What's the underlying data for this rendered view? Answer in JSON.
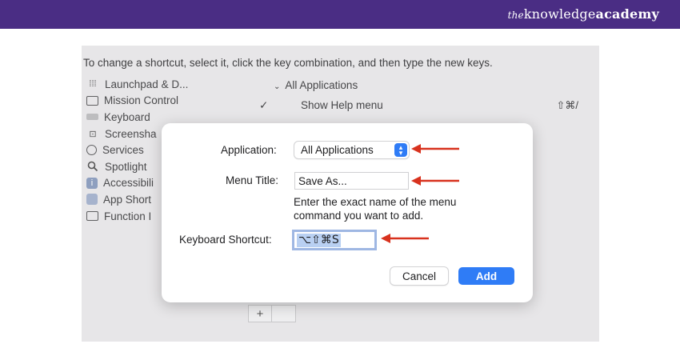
{
  "banner": {
    "brand_the": "the",
    "brand_knowledge": "knowledge",
    "brand_academy": "academy"
  },
  "instruction": "To change a shortcut, select it, click the key combination, and then type the new keys.",
  "sidebar": {
    "items": [
      {
        "label": "Launchpad & D...",
        "icon": "launchpad-icon"
      },
      {
        "label": "Mission Control",
        "icon": "mission-control-icon"
      },
      {
        "label": "Keyboard",
        "icon": "keyboard-icon"
      },
      {
        "label": "Screensha",
        "icon": "screenshot-icon"
      },
      {
        "label": "Services",
        "icon": "services-icon"
      },
      {
        "label": "Spotlight",
        "icon": "spotlight-icon"
      },
      {
        "label": "Accessibili",
        "icon": "accessibility-icon"
      },
      {
        "label": "App Short",
        "icon": "app-shortcuts-icon"
      },
      {
        "label": "Function I",
        "icon": "function-keys-icon"
      }
    ]
  },
  "shortcut_list": {
    "group_label": "All Applications",
    "row_label": "Show Help menu",
    "row_shortcut": "⇧⌘/",
    "add_symbol": "+",
    "remove_symbol": ""
  },
  "dialog": {
    "application_label": "Application:",
    "application_value": "All Applications",
    "menu_title_label": "Menu Title:",
    "menu_title_value": "Save As...",
    "hint_line1": "Enter the exact name of the menu",
    "hint_line2": "command you want to add.",
    "shortcut_label": "Keyboard Shortcut:",
    "shortcut_value": "⌥⇧⌘S",
    "cancel_label": "Cancel",
    "add_label": "Add"
  },
  "colors": {
    "banner": "#4a2d84",
    "accent": "#2f7cf6",
    "arrow": "#d8321e"
  }
}
